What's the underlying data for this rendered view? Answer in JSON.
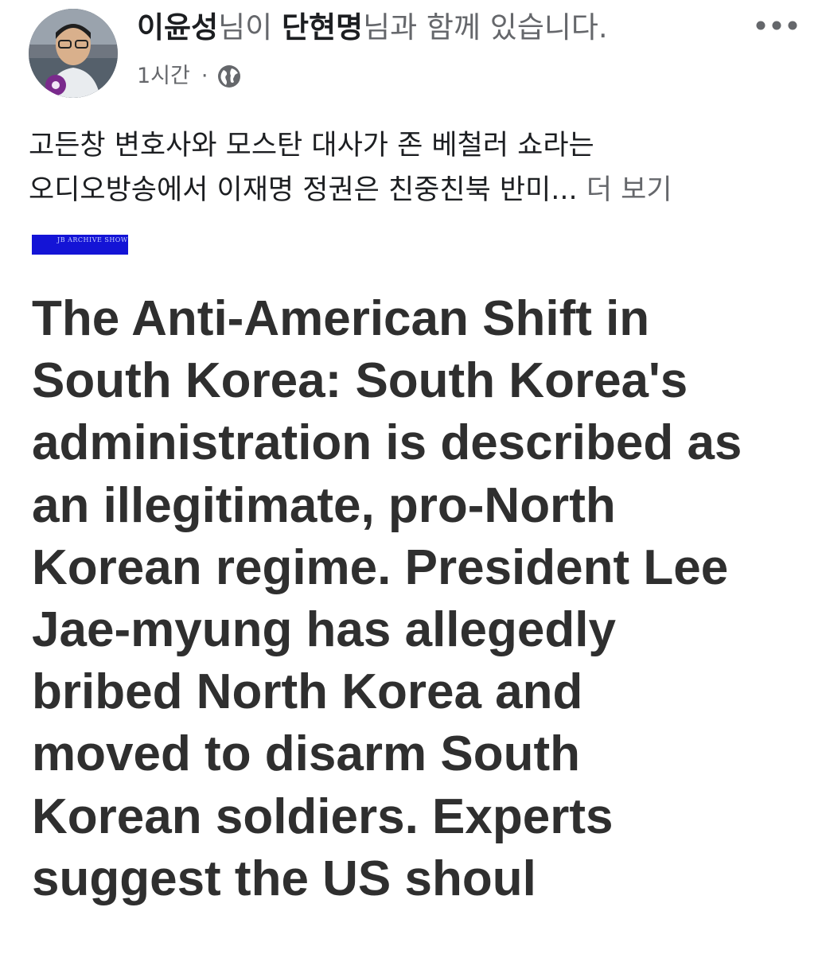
{
  "post": {
    "author": "이윤성",
    "author_suffix": "님이 ",
    "tagged": "단현명",
    "tagged_suffix": "님과 함께 있습니다.",
    "time": "1시간",
    "dot": "·",
    "audience_icon": "globe-icon",
    "more_icon": "more-horizontal-icon",
    "body_lines": [
      "고든창 변호사와 모스탄 대사가 존 베철러 쇼라는",
      "오디오방송에서 이재명 정권은 친중친북 반미... "
    ],
    "see_more": "더 보기"
  },
  "image": {
    "banner_text": "JB ARCHIVE SHOW",
    "banner_color": "#1414d6",
    "headline_lines": [
      "The Anti-American Shift in",
      "South Korea: South Korea's",
      "administration is described as",
      "an illegitimate, pro-North",
      "Korean regime. President Lee",
      "Jae-myung has allegedly",
      "bribed North Korea and",
      "moved to disarm South",
      "Korean soldiers. Experts",
      "suggest the US shoul"
    ]
  },
  "colors": {
    "primary_text": "#1c1e21",
    "secondary_text": "#65676b",
    "headline_text": "#2f2f2f"
  }
}
